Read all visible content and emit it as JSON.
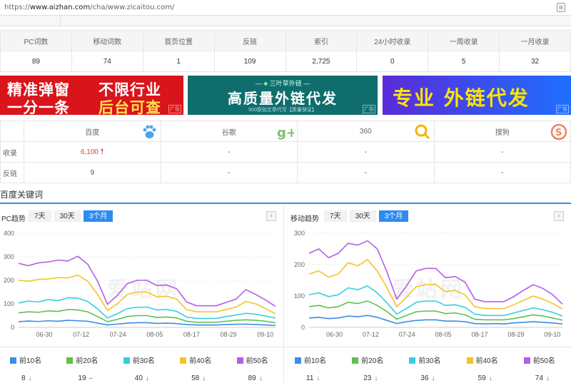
{
  "browser": {
    "url_prefix": "https://",
    "url_host": "www.aizhan.com",
    "url_path": "/cha/www.zicaitou.com/"
  },
  "stats": {
    "headers": [
      "PC词数",
      "移动词数",
      "首页位置",
      "反链",
      "索引",
      "24小时收录",
      "一周收录",
      "一月收录"
    ],
    "values": [
      "89",
      "74",
      "1",
      "109",
      "2,725",
      "0",
      "5",
      "32"
    ]
  },
  "ads": {
    "ad1": {
      "line1_left": "精准弹窗",
      "line2_left": "一分一条",
      "line1_right": "不限行业",
      "line2_right": "后台可查",
      "tag": "广告"
    },
    "ad2": {
      "top": "三叶草外链",
      "main": "高质量外链代发",
      "bottom": "500原创文章代写【质量保证】",
      "tag": "广告"
    },
    "ad3": {
      "main": "专业 外链代发",
      "tag": "广告"
    }
  },
  "engines": {
    "headers": [
      "百度",
      "谷歌",
      "360",
      "搜狗"
    ],
    "icons": [
      "baidu-paw-icon",
      "google-plus-icon",
      "360-search-icon",
      "sogou-icon"
    ],
    "rows": [
      {
        "label": "收录",
        "values": [
          "6,100",
          "-",
          "-",
          "-"
        ]
      },
      {
        "label": "反链",
        "values": [
          "9",
          "-",
          "-",
          "-"
        ]
      }
    ]
  },
  "section_title": "百度关键词",
  "range_buttons": [
    "7天",
    "30天",
    "3个月"
  ],
  "active_range": "3个月",
  "watermark": "爱站网",
  "series_colors": [
    "#3a8ee6",
    "#5cc24a",
    "#36cfe0",
    "#f5c22a",
    "#b45ee8"
  ],
  "legend": [
    "前10名",
    "前20名",
    "前30名",
    "前40名",
    "前50名"
  ],
  "pc": {
    "title": "PC趋势",
    "ranks": [
      {
        "value": "8",
        "trend": "down"
      },
      {
        "value": "19",
        "trend": "flat"
      },
      {
        "value": "40",
        "trend": "down"
      },
      {
        "value": "58",
        "trend": "down"
      },
      {
        "value": "89",
        "trend": "down"
      }
    ]
  },
  "mobile": {
    "title": "移动趋势",
    "ranks": [
      {
        "value": "11",
        "trend": "down"
      },
      {
        "value": "23",
        "trend": "down"
      },
      {
        "value": "36",
        "trend": "down"
      },
      {
        "value": "59",
        "trend": "down"
      },
      {
        "value": "74",
        "trend": "down"
      }
    ]
  },
  "chart_data": [
    {
      "type": "line",
      "title": "PC趋势",
      "x_ticks": [
        "06-30",
        "07-12",
        "07-24",
        "08-05",
        "08-17",
        "08-29",
        "09-10"
      ],
      "ylim": [
        0,
        400
      ],
      "y_ticks": [
        0,
        100,
        200,
        300,
        400
      ],
      "grid": true,
      "series": [
        {
          "name": "前10名",
          "values": [
            24,
            27,
            25,
            28,
            26,
            30,
            28,
            26,
            18,
            10,
            14,
            18,
            20,
            20,
            17,
            18,
            16,
            12,
            10,
            10,
            10,
            12,
            13,
            14,
            12,
            10,
            8
          ]
        },
        {
          "name": "前20名",
          "values": [
            62,
            66,
            64,
            70,
            68,
            76,
            74,
            66,
            46,
            24,
            34,
            46,
            50,
            50,
            42,
            44,
            40,
            26,
            22,
            22,
            22,
            26,
            30,
            32,
            30,
            26,
            19
          ]
        },
        {
          "name": "前30名",
          "values": [
            104,
            112,
            108,
            118,
            114,
            126,
            124,
            110,
            78,
            40,
            58,
            80,
            86,
            86,
            74,
            76,
            68,
            44,
            38,
            38,
            38,
            46,
            52,
            60,
            56,
            48,
            40
          ]
        },
        {
          "name": "前40名",
          "values": [
            200,
            196,
            204,
            206,
            212,
            210,
            222,
            196,
            140,
            72,
            100,
            140,
            150,
            150,
            130,
            132,
            120,
            76,
            66,
            66,
            66,
            76,
            86,
            110,
            100,
            80,
            58
          ]
        },
        {
          "name": "前50名",
          "values": [
            272,
            262,
            274,
            278,
            286,
            282,
            302,
            268,
            196,
            98,
            136,
            186,
            200,
            200,
            178,
            180,
            164,
            108,
            92,
            92,
            92,
            106,
            120,
            160,
            140,
            116,
            89
          ]
        }
      ]
    },
    {
      "type": "line",
      "title": "移动趋势",
      "x_ticks": [
        "06-30",
        "07-12",
        "07-24",
        "08-05",
        "08-17",
        "08-29",
        "09-10"
      ],
      "ylim": [
        0,
        300
      ],
      "y_ticks": [
        0,
        100,
        200,
        300
      ],
      "grid": true,
      "series": [
        {
          "name": "前10名",
          "values": [
            30,
            32,
            28,
            30,
            36,
            34,
            38,
            32,
            22,
            12,
            18,
            22,
            24,
            24,
            20,
            20,
            18,
            12,
            11,
            12,
            11,
            14,
            16,
            18,
            16,
            14,
            11
          ]
        },
        {
          "name": "前20名",
          "values": [
            66,
            70,
            62,
            66,
            80,
            76,
            84,
            70,
            50,
            26,
            38,
            50,
            52,
            52,
            44,
            46,
            40,
            26,
            24,
            24,
            24,
            28,
            34,
            40,
            36,
            30,
            23
          ]
        },
        {
          "name": "前30名",
          "values": [
            104,
            110,
            98,
            104,
            126,
            120,
            132,
            110,
            78,
            42,
            60,
            80,
            84,
            84,
            70,
            72,
            64,
            42,
            38,
            38,
            38,
            46,
            54,
            62,
            56,
            48,
            36
          ]
        },
        {
          "name": "前40名",
          "values": [
            170,
            180,
            160,
            170,
            206,
            196,
            216,
            180,
            126,
            66,
            96,
            130,
            136,
            136,
            114,
            118,
            104,
            66,
            60,
            60,
            60,
            72,
            86,
            100,
            90,
            76,
            59
          ]
        },
        {
          "name": "前50名",
          "values": [
            236,
            250,
            222,
            236,
            268,
            262,
            276,
            250,
            176,
            90,
            132,
            180,
            188,
            188,
            158,
            162,
            144,
            90,
            82,
            82,
            82,
            98,
            118,
            136,
            124,
            104,
            74
          ]
        }
      ]
    }
  ]
}
